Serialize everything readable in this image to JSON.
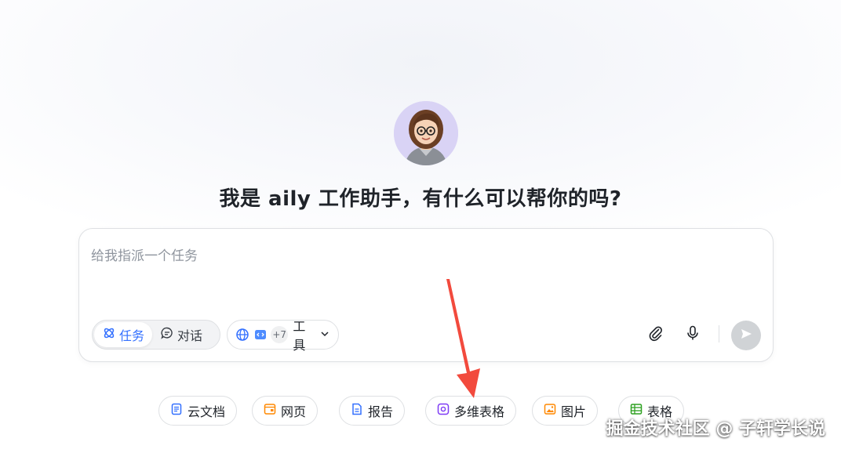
{
  "assistant": {
    "avatar_icon": "assistant-avatar",
    "greeting": "我是 aily 工作助手，有什么可以帮你的吗?"
  },
  "composer": {
    "placeholder": "给我指派一个任务",
    "value": "",
    "modes": [
      {
        "label": "任务",
        "icon": "task-mode-icon",
        "active": true
      },
      {
        "label": "对话",
        "icon": "chat-bubble-icon",
        "active": false
      }
    ],
    "tools": {
      "icons": [
        "globe-icon",
        "code-block-icon"
      ],
      "more_count": "+7",
      "label": "工具"
    },
    "attach_icon": "paperclip-icon",
    "mic_icon": "microphone-icon",
    "send_icon": "send-icon"
  },
  "quick_actions": [
    {
      "label": "云文档",
      "icon": "doc-icon",
      "color": "#3370ff"
    },
    {
      "label": "网页",
      "icon": "webpage-icon",
      "color": "#ff8800"
    },
    {
      "label": "报告",
      "icon": "report-icon",
      "color": "#3370ff"
    },
    {
      "label": "多维表格",
      "icon": "base-table-icon",
      "color": "#7f3bf5"
    },
    {
      "label": "图片",
      "icon": "image-icon",
      "color": "#ff8800"
    },
    {
      "label": "表格",
      "icon": "sheet-icon",
      "color": "#2ea121"
    }
  ],
  "annotation": {
    "arrow_color": "#f24a3d"
  },
  "watermark": "掘金技术社区 @ 子轩学长说",
  "colors": {
    "accent": "#3370ff",
    "send_disabled": "#d0d3d6"
  }
}
